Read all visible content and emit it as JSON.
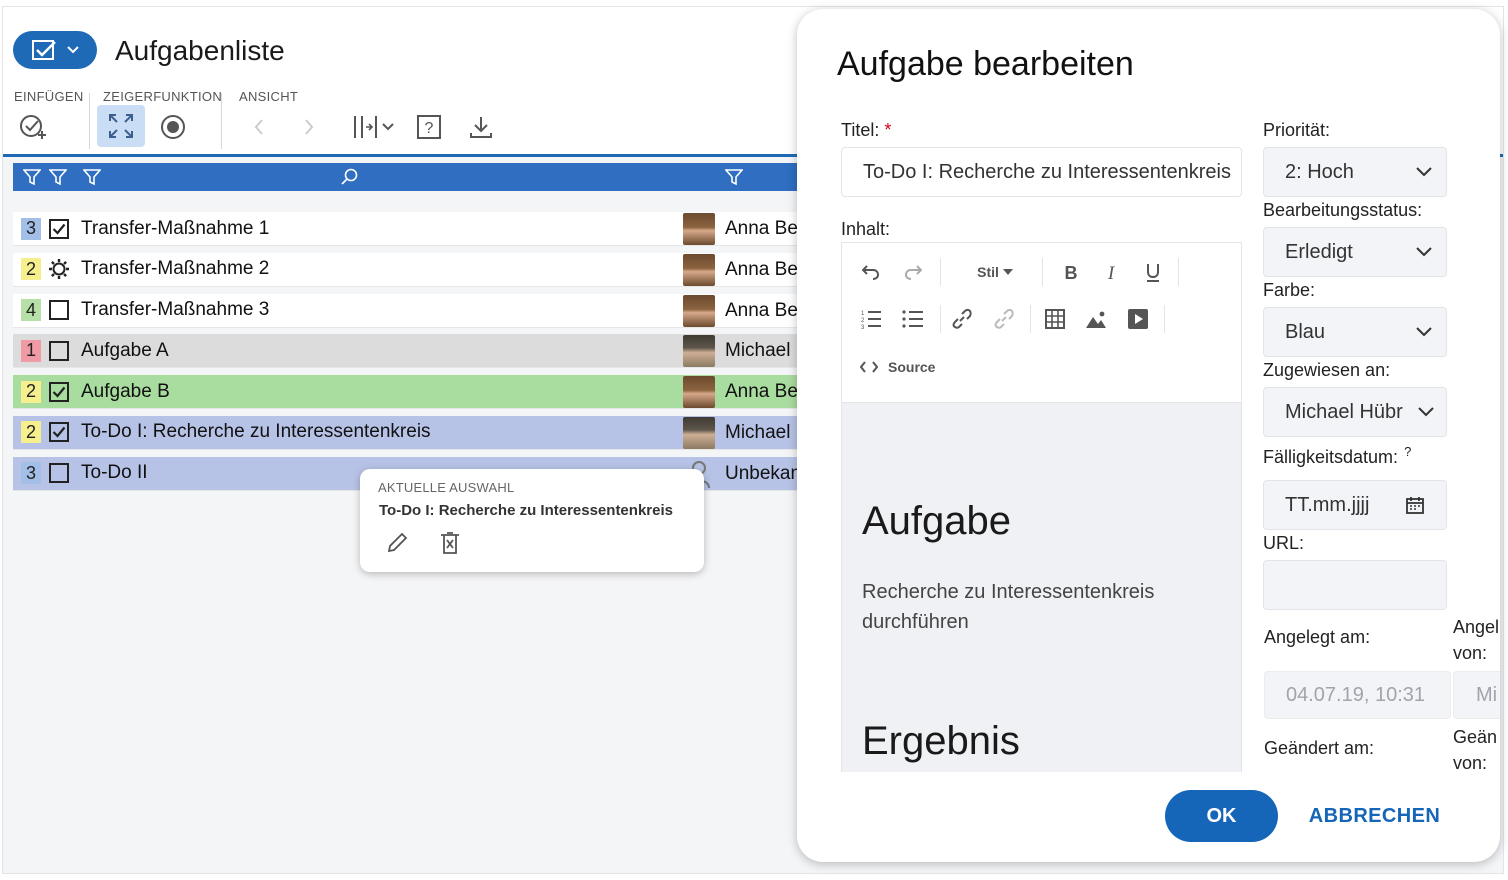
{
  "app": {
    "title": "Aufgabenliste",
    "ribbon": {
      "group_insert": "EINFÜGEN",
      "group_pointer": "ZEIGERFUNKTION",
      "group_view": "ANSICHT"
    }
  },
  "rows": [
    {
      "priority": "3",
      "priority_color": "#a3bfe8",
      "status": "checked",
      "title": "Transfer-Maßnahme 1",
      "person": "Anna Be",
      "avatar": "anna",
      "row_color": "white"
    },
    {
      "priority": "2",
      "priority_color": "#f5ef8e",
      "status": "in-progress",
      "title": "Transfer-Maßnahme 2",
      "person": "Anna Be",
      "avatar": "anna",
      "row_color": "white"
    },
    {
      "priority": "4",
      "priority_color": "#b6e0a8",
      "status": "unchecked",
      "title": "Transfer-Maßnahme 3",
      "person": "Anna Be",
      "avatar": "anna",
      "row_color": "white"
    },
    {
      "priority": "1",
      "priority_color": "#ef9aa5",
      "status": "unchecked",
      "title": "Aufgabe A",
      "person": "Michael I",
      "avatar": "michael",
      "row_color": "gray"
    },
    {
      "priority": "2",
      "priority_color": "#f5ef8e",
      "status": "checked",
      "title": "Aufgabe B",
      "person": "Anna Be",
      "avatar": "anna",
      "row_color": "green"
    },
    {
      "priority": "2",
      "priority_color": "#f5ef8e",
      "status": "checked",
      "title": "To-Do I: Recherche zu Interessentenkreis",
      "person": "Michael I",
      "avatar": "michael",
      "row_color": "blue"
    },
    {
      "priority": "3",
      "priority_color": "#a3bfe8",
      "status": "unchecked",
      "title": "To-Do II",
      "person": "Unbekan",
      "avatar": "unknown",
      "row_color": "blue"
    }
  ],
  "popover": {
    "label": "AKTUELLE AUSWAHL",
    "title": "To-Do I: Recherche zu Interessentenkreis"
  },
  "dialog": {
    "title": "Aufgabe bearbeiten",
    "titel_label": "Titel:",
    "required_mark": "*",
    "titel_value": "To-Do I: Recherche zu Interessentenkreis",
    "inhalt_label": "Inhalt:",
    "editor": {
      "stil_label": "Stil",
      "source_label": "Source",
      "heading1": "Aufgabe",
      "paragraph": "Recherche zu Interessentenkreis durchführen",
      "heading2": "Ergebnis"
    },
    "prioritaet_label": "Priorität:",
    "prioritaet_value": "2: Hoch",
    "status_label": "Bearbeitungsstatus:",
    "status_value": "Erledigt",
    "farbe_label": "Farbe:",
    "farbe_value": "Blau",
    "zugewiesen_label": "Zugewiesen an:",
    "zugewiesen_value": "Michael Hübr",
    "faellig_label": "Fälligkeitsdatum:",
    "faellig_help": "?",
    "faellig_placeholder": "TT.mm.jjjj",
    "url_label": "URL:",
    "angelegt_am_label": "Angelegt am:",
    "angelegt_am_value": "04.07.19, 10:31",
    "angelegt_von_label_1": "Angel",
    "angelegt_von_label_2": "von:",
    "angelegt_von_value": "Mi",
    "geaendert_am_label": "Geändert am:",
    "geaendert_von_label_1": "Geän",
    "geaendert_von_label_2": "von:",
    "ok_label": "OK",
    "cancel_label": "ABBRECHEN"
  },
  "colors": {
    "accent": "#1f6ab7",
    "filter_bar": "#2f6ec1",
    "row_gray": "#dcdcdc",
    "row_green": "#a9dc9f",
    "row_blue": "#b7c3e6"
  }
}
